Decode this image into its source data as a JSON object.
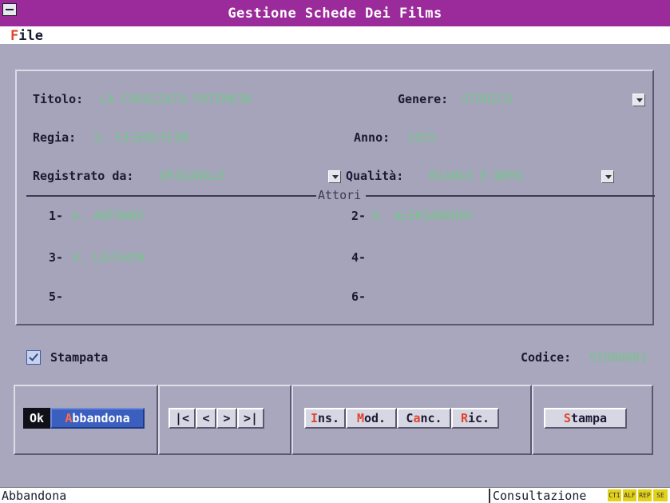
{
  "window": {
    "title": "Gestione Schede Dei Films"
  },
  "menu": {
    "file_hotkey": "F",
    "file_rest": "ile"
  },
  "form": {
    "titolo_label": "Titolo:",
    "titolo_value": "LA CORAZZATA POTEMKIN",
    "genere_label": "Genere:",
    "genere_value": "STORICO",
    "regia_label": "Regia:",
    "regia_value": "S. EISENSTEIN",
    "anno_label": "Anno:",
    "anno_value": "1925",
    "registrato_label": "Registrato da:",
    "registrato_value": "ORIGINALE",
    "qualita_label": "Qualità:",
    "qualita_value": "BIANCO E NERO",
    "attori_legend": "Attori",
    "actors": [
      {
        "num": "1-",
        "name": "A. ANTONOV"
      },
      {
        "num": "2-",
        "name": "G. ALEKSANDROV"
      },
      {
        "num": "3-",
        "name": "A. LEVSHIN"
      },
      {
        "num": "4-",
        "name": ""
      },
      {
        "num": "5-",
        "name": ""
      },
      {
        "num": "6-",
        "name": ""
      }
    ]
  },
  "stampata": {
    "label": "Stampata",
    "checked": true
  },
  "codice": {
    "label": "Codice:",
    "value": "STO00001"
  },
  "buttons": {
    "ok": "Ok",
    "abbandona_hot": "A",
    "abbandona_rest": "bbandona",
    "first": "|<",
    "prev": "<",
    "next": ">",
    "last": ">|",
    "ins_hot": "I",
    "ins_rest": "ns.",
    "mod_hot": "M",
    "mod_rest": "od.",
    "canc_pre": "C",
    "canc_hot": "a",
    "canc_rest": "nc.",
    "ric_hot": "R",
    "ric_rest": "ic.",
    "stampa_hot": "S",
    "stampa_rest": "tampa"
  },
  "statusbar": {
    "message": "Abbandona",
    "mode": "Consultazione",
    "indicators": [
      "CTI",
      "ALF",
      "REP",
      "SE"
    ]
  },
  "colors": {
    "titlebar": "#9b2a9b",
    "background": "#a9a7bd",
    "field_value": "#74c58a",
    "hotkey": "#e0442c",
    "abbandona_button": "#3b5fbf",
    "status_indicator": "#e3d21a"
  }
}
